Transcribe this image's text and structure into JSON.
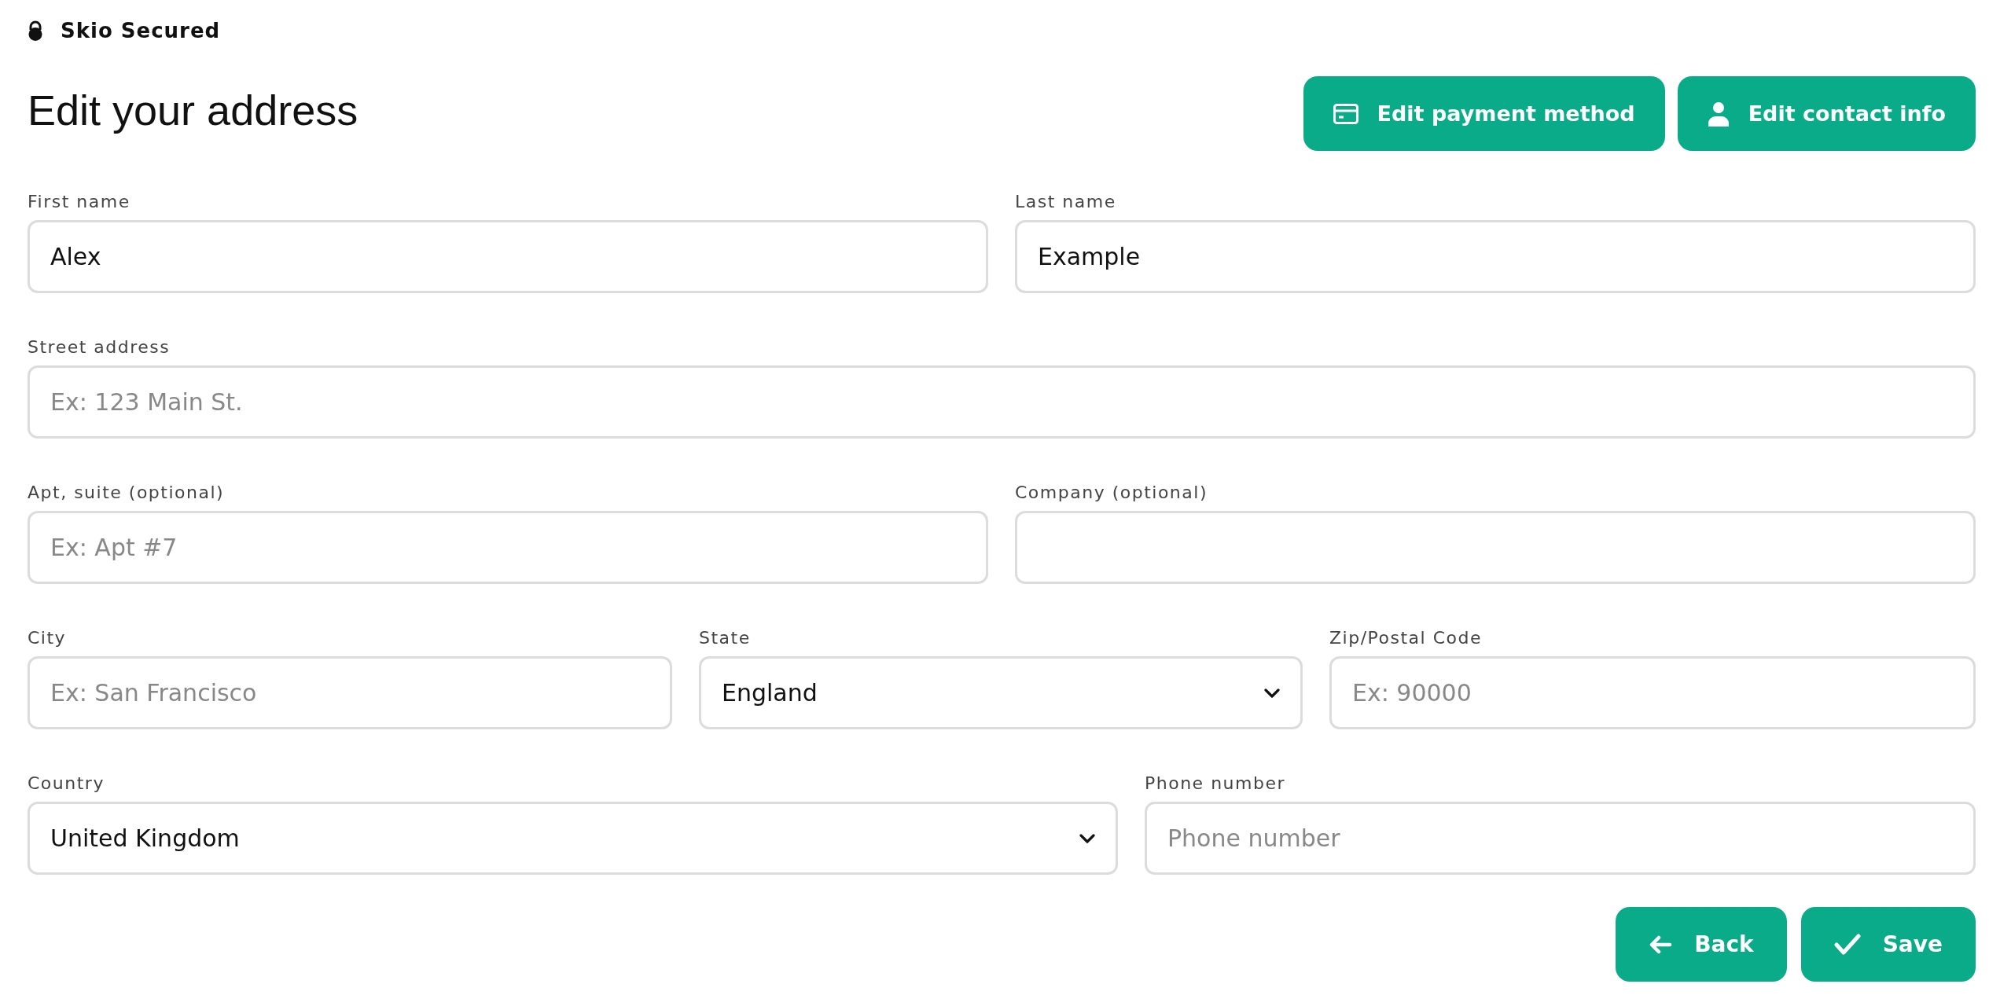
{
  "header": {
    "brand": "Skio Secured"
  },
  "page_title": "Edit your address",
  "top_buttons": [
    {
      "kind": "card",
      "label": "Edit payment method"
    },
    {
      "kind": "person",
      "label": "Edit contact info"
    }
  ],
  "form_rows": [
    [
      {
        "kind": "text",
        "label": "First name",
        "value": "Alex"
      },
      {
        "kind": "text",
        "label": "Last name",
        "value": "Example"
      }
    ],
    [
      {
        "kind": "text",
        "label": "Street address",
        "placeholder": "Ex: 123 Main St."
      }
    ],
    [
      {
        "kind": "text",
        "label": "Apt, suite (optional)",
        "placeholder": "Ex: Apt #7"
      },
      {
        "kind": "text",
        "label": "Company (optional)"
      }
    ],
    [
      {
        "kind": "text",
        "label": "City",
        "placeholder": "Ex: San Francisco"
      },
      {
        "kind": "select",
        "label": "State",
        "value": "England"
      },
      {
        "kind": "text",
        "label": "Zip/Postal Code",
        "placeholder": "Ex: 90000"
      }
    ],
    [
      {
        "kind": "select",
        "label": "Country",
        "value": "United Kingdom"
      },
      {
        "kind": "text",
        "label": "Phone number",
        "placeholder": "Phone number"
      }
    ]
  ],
  "bottom_buttons": [
    {
      "kind": "back",
      "label": "Back"
    },
    {
      "kind": "save",
      "label": "Save"
    }
  ]
}
